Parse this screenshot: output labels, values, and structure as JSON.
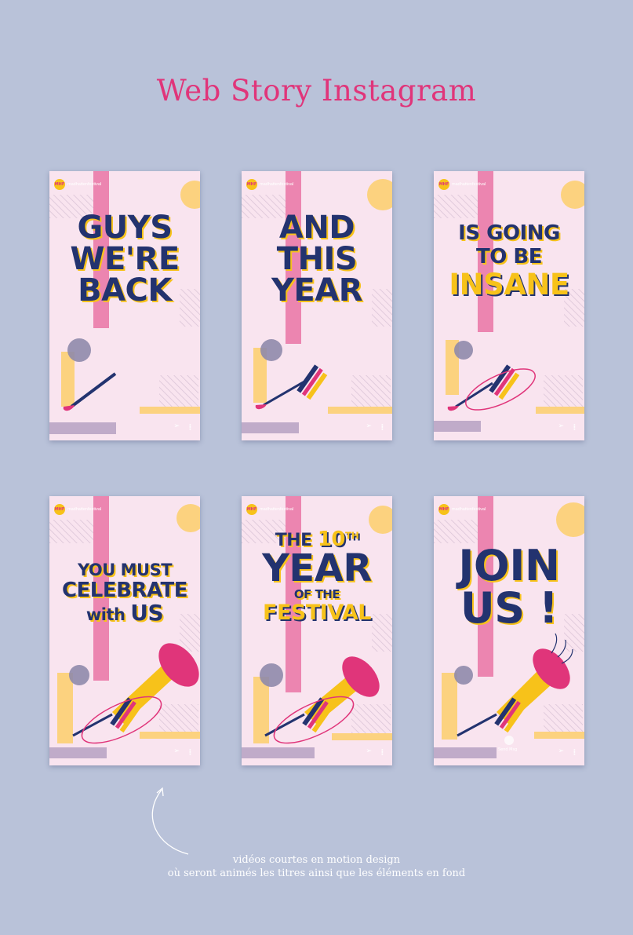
{
  "title": "Web Story Instagram",
  "account": "madhattenfestival",
  "logo_text": "MHF",
  "story_icons": {
    "share": "send-icon",
    "more": "more-vertical-icon"
  },
  "colors": {
    "background": "#b9c2d9",
    "story": "#f9e4ef",
    "navy": "#23336f",
    "yellow": "#f7c21a",
    "pink": "#e0357a"
  },
  "stories": [
    {
      "lines": [
        "GUYS",
        "WE'RE",
        "BACK"
      ]
    },
    {
      "lines": [
        "AND",
        "THIS",
        "YEAR"
      ]
    },
    {
      "lines": [
        "IS GOING",
        "TO BE",
        "INSANE"
      ]
    },
    {
      "lines": [
        "YOU MUST",
        "CELEBRATE",
        "with",
        "US"
      ]
    },
    {
      "lines": [
        "THE",
        "10",
        "TH",
        "YEAR",
        "OF THE",
        "FESTIVAL"
      ]
    },
    {
      "lines": [
        "JOIN",
        "US !"
      ]
    }
  ],
  "send_message_label": "Send Msg",
  "caption": {
    "line1": "vidéos courtes en motion design",
    "line2": "où seront animés les titres ainsi que les éléments en fond"
  }
}
